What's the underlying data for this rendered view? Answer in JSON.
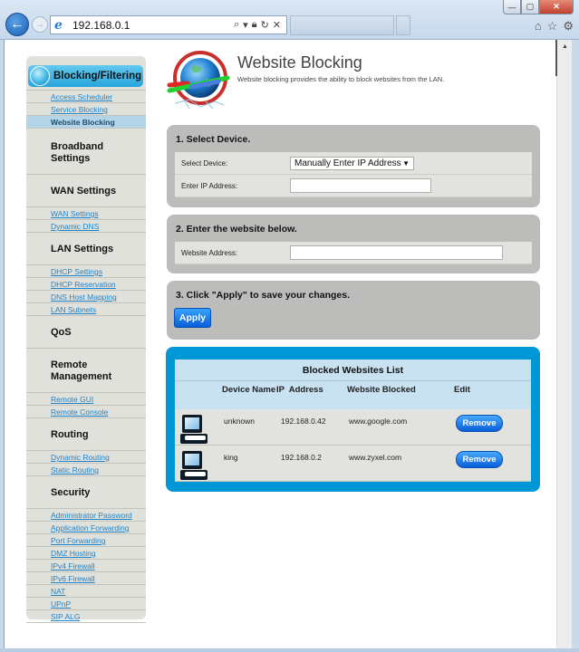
{
  "browser": {
    "address": "192.168.0.1",
    "window_controls": {
      "minimize": "—",
      "maximize": "▢",
      "close": "✕"
    },
    "icons": [
      "back-icon",
      "forward-icon",
      "ie-logo-icon",
      "search-icon",
      "lock-icon",
      "refresh-icon",
      "stop-icon",
      "home-icon",
      "favorites-star-icon",
      "settings-gear-icon"
    ]
  },
  "sidebar": {
    "active_section": "Blocking/Filtering",
    "active_links": [
      {
        "label": "Access Scheduler",
        "current": false
      },
      {
        "label": "Service Blocking",
        "current": false
      },
      {
        "label": "Website Blocking",
        "current": true
      }
    ],
    "sections": [
      {
        "heading": "Broadband Settings",
        "links": []
      },
      {
        "heading": "WAN Settings",
        "links": [
          "WAN Settings",
          "Dynamic DNS"
        ]
      },
      {
        "heading": "LAN Settings",
        "links": [
          "DHCP Settings",
          "DHCP Reservation",
          "DNS Host Mapping",
          "LAN Subnets"
        ]
      },
      {
        "heading": "QoS",
        "links": []
      },
      {
        "heading": "Remote Management",
        "links": [
          "Remote GUI",
          "Remote Console"
        ]
      },
      {
        "heading": "Routing",
        "links": [
          "Dynamic Routing",
          "Static Routing"
        ]
      },
      {
        "heading": "Security",
        "links": [
          "Administrator Password",
          "Application Forwarding",
          "Port Forwarding",
          "DMZ Hosting",
          "IPv4 Firewall",
          "IPv6 Firewall",
          "NAT",
          "UPnP",
          "SIP ALG"
        ]
      }
    ]
  },
  "header": {
    "title": "Website Blocking",
    "description": "Website blocking provides the ability to block websites from the LAN."
  },
  "step1": {
    "title": "1. Select Device.",
    "select_label": "Select Device:",
    "select_value": "Manually Enter IP Address",
    "ip_label": "Enter IP Address:",
    "ip_value": ""
  },
  "step2": {
    "title": "2. Enter the website below.",
    "website_label": "Website Address:",
    "website_value": ""
  },
  "step3": {
    "title": "3. Click \"Apply\" to save your changes.",
    "apply_label": "Apply"
  },
  "blocked_list": {
    "title": "Blocked Websites List",
    "columns": [
      "Device Name",
      "IP  Address",
      "Website Blocked",
      "Edit"
    ],
    "rows": [
      {
        "device": "unknown",
        "ip": "192.168.0.42",
        "website": "www.google.com",
        "action": "Remove"
      },
      {
        "device": "king",
        "ip": "192.168.0.2",
        "website": "www.zyxel.com",
        "action": "Remove"
      }
    ]
  }
}
